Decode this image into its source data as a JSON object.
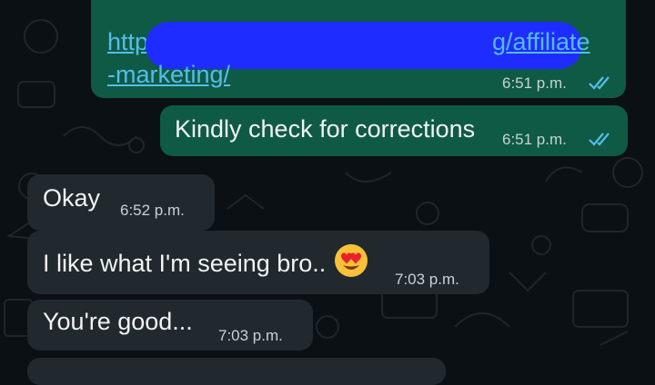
{
  "messages": [
    {
      "direction": "outgoing",
      "link_start": "http",
      "link_end": "g/affiliate",
      "link_line2": "-marketing/",
      "time": "6:51 p.m.",
      "status": "read-double-check-icon"
    },
    {
      "direction": "outgoing",
      "text": "Kindly check for corrections",
      "time": "6:51 p.m.",
      "status": "read-double-check-icon"
    },
    {
      "direction": "incoming",
      "text": "Okay",
      "time": "6:52 p.m."
    },
    {
      "direction": "incoming",
      "text": "I like what I'm seeing bro..",
      "emoji": "smiling-face-with-heart-eyes-icon",
      "time": "7:03 p.m."
    },
    {
      "direction": "incoming",
      "text": "You're good...",
      "time": "7:03 p.m."
    }
  ],
  "colors": {
    "background": "#0b1014",
    "outgoing_bubble": "#0f5a45",
    "incoming_bubble": "#21292e",
    "link": "#53bdeb",
    "read_ticks": "#53bdeb",
    "redaction": "#1f2cff"
  }
}
